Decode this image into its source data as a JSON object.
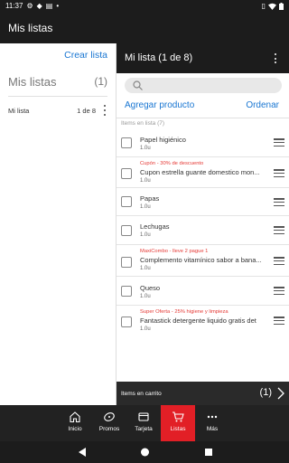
{
  "status_bar": {
    "time": "11:37",
    "icons": [
      "settings-icon",
      "notification-icon",
      "doc-icon",
      "dot-icon",
      "vibrate-icon",
      "wifi-icon",
      "battery-icon"
    ]
  },
  "app": {
    "title": "Mis listas"
  },
  "left_pane": {
    "create_label": "Crear lista",
    "section_title": "Mis listas",
    "section_count": "(1)",
    "lists": [
      {
        "name": "Mi lista",
        "position": "1 de 8"
      }
    ]
  },
  "list_view": {
    "title": "Mi lista (1 de 8)",
    "search_placeholder": "",
    "add_label": "Agregar producto",
    "sort_label": "Ordenar",
    "items_header": "Items en lista (7)",
    "items": [
      {
        "promo": "",
        "name": "Papel higiénico",
        "qty": "1.0u"
      },
      {
        "promo": "Cupón - 30% de descuento",
        "name": "Cupon estrella guante domestico mon...",
        "qty": "1.0u"
      },
      {
        "promo": "",
        "name": "Papas",
        "qty": "1.0u"
      },
      {
        "promo": "",
        "name": "Lechugas",
        "qty": "1.0u"
      },
      {
        "promo": "MaxiCombo - lleve 2 pague 1",
        "name": "Complemento vitamínico sabor a bana...",
        "qty": "1.0u"
      },
      {
        "promo": "",
        "name": "Queso",
        "qty": "1.0u"
      },
      {
        "promo": "Super Oferta - 25% higiene y limpieza",
        "name": "Fantastick detergente liquido gratis det",
        "qty": "1.0u"
      }
    ],
    "cart_label": "Items en carrito",
    "cart_count": "(1)"
  },
  "bottom_nav": {
    "items": [
      {
        "label": "Inicio",
        "icon": "home-icon"
      },
      {
        "label": "Promos",
        "icon": "promo-tag-icon"
      },
      {
        "label": "Tarjeta",
        "icon": "card-icon"
      },
      {
        "label": "Listas",
        "icon": "cart-icon",
        "active": true
      },
      {
        "label": "Más",
        "icon": "more-icon"
      }
    ]
  },
  "colors": {
    "accent": "#1976d2",
    "active_nav": "#e21f26",
    "promo_text": "#e53935",
    "bar": "#1c1c1c"
  }
}
